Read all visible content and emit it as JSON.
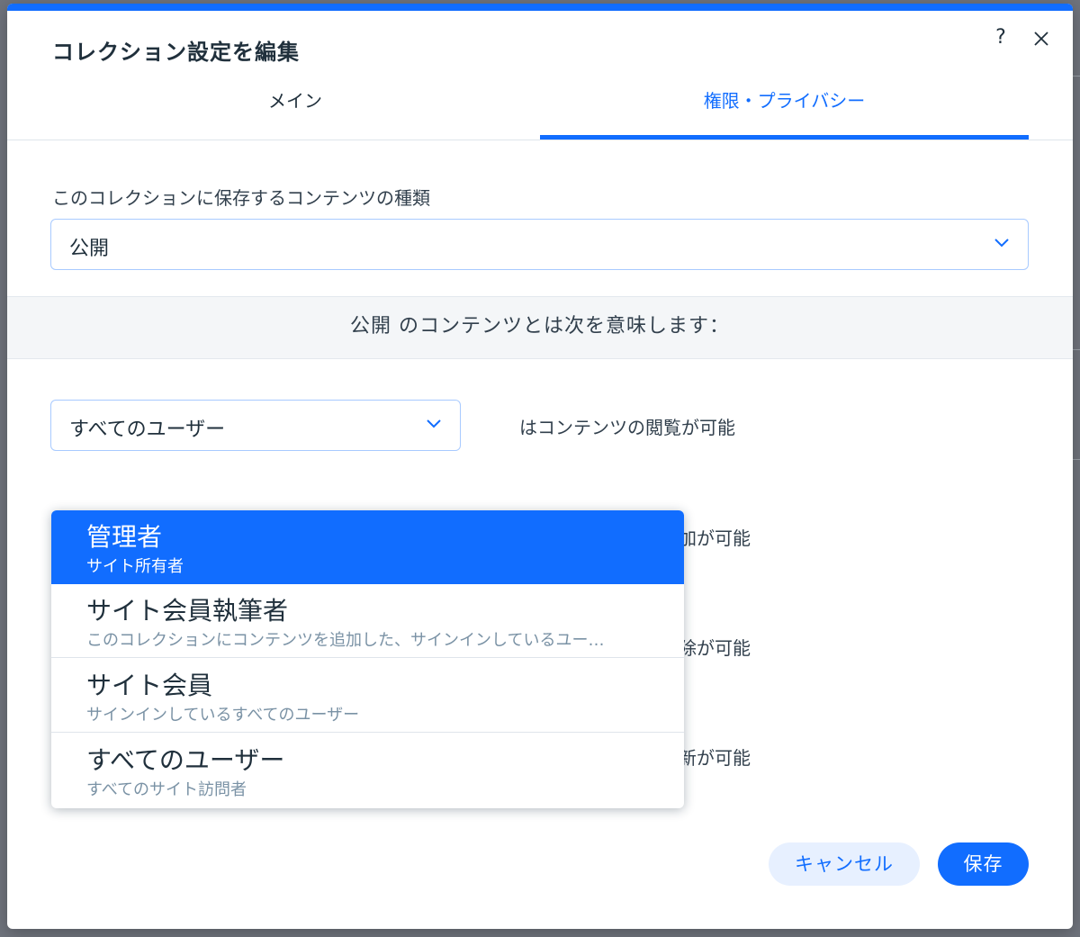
{
  "dialog": {
    "title": "コレクション設定を編集",
    "help_label": "?",
    "icons": {
      "close": "close-icon",
      "chevron": "chevron-down-icon"
    }
  },
  "tabs": [
    {
      "label": "メイン",
      "active": false
    },
    {
      "label": "権限・プライバシー",
      "active": true
    }
  ],
  "content_type": {
    "label": "このコレクションに保存するコンテンツの種類",
    "value": "公開"
  },
  "meaning_banner": "公開 のコンテンツとは次を意味します：",
  "permissions": [
    {
      "selected": "すべてのユーザー",
      "text": "はコンテンツの閲覧が可能"
    },
    {
      "text_visible": "加が可能"
    },
    {
      "text_visible": "除が可能"
    },
    {
      "text_visible": "新が可能"
    }
  ],
  "dropdown": {
    "options": [
      {
        "title": "管理者",
        "subtitle": "サイト所有者",
        "highlighted": true
      },
      {
        "title": "サイト会員執筆者",
        "subtitle": "このコレクションにコンテンツを追加した、サインインしているユー…",
        "highlighted": false
      },
      {
        "title": "サイト会員",
        "subtitle": "サインインしているすべてのユーザー",
        "highlighted": false
      },
      {
        "title": "すべてのユーザー",
        "subtitle": "すべてのサイト訪問者",
        "highlighted": false
      }
    ]
  },
  "buttons": {
    "cancel": "キャンセル",
    "save": "保存"
  },
  "colors": {
    "accent": "#116dff",
    "text": "#20303c",
    "muted": "#7a92a5"
  }
}
